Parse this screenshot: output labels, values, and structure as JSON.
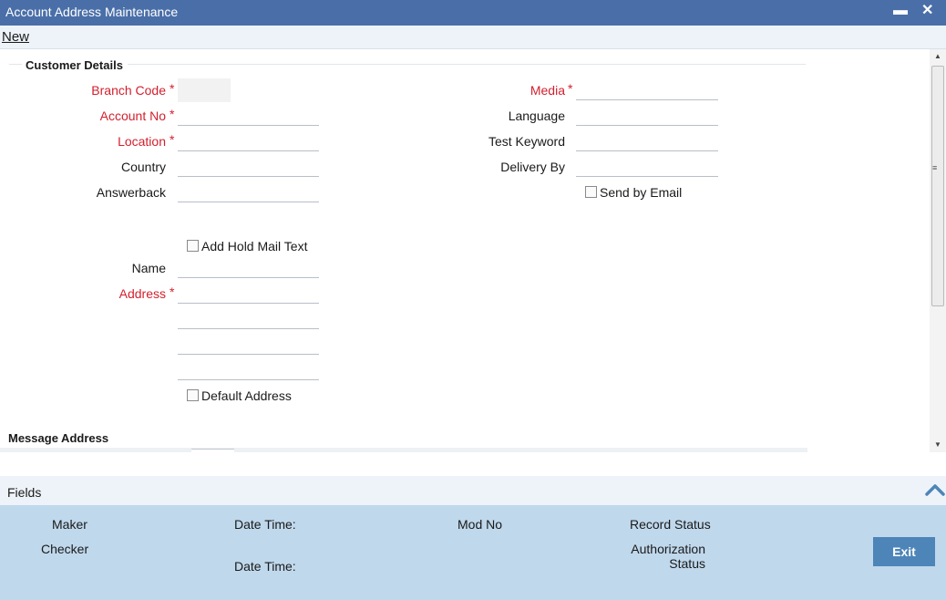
{
  "window": {
    "title": "Account Address Maintenance",
    "minimize_icon": "minimize-icon",
    "close_icon": "close-icon"
  },
  "menu": {
    "new_label": "New"
  },
  "customer_details": {
    "title": "Customer Details",
    "required_marker": "*",
    "branch_code": {
      "label": "Branch Code",
      "value": ""
    },
    "account_no": {
      "label": "Account No",
      "value": ""
    },
    "location": {
      "label": "Location",
      "value": ""
    },
    "country": {
      "label": "Country",
      "value": ""
    },
    "answerback": {
      "label": "Answerback",
      "value": ""
    },
    "media": {
      "label": "Media",
      "value": ""
    },
    "language": {
      "label": "Language",
      "value": ""
    },
    "test_keyword": {
      "label": "Test Keyword",
      "value": ""
    },
    "delivery_by": {
      "label": "Delivery By",
      "value": ""
    },
    "send_by_email": {
      "label": "Send by Email",
      "checked": false
    },
    "add_hold_mail_text": {
      "label": "Add Hold Mail Text",
      "checked": false
    },
    "name": {
      "label": "Name",
      "value": ""
    },
    "address": {
      "label": "Address",
      "lines": [
        "",
        "",
        "",
        ""
      ]
    },
    "default_address": {
      "label": "Default Address",
      "checked": false
    }
  },
  "message_address": {
    "title": "Message Address"
  },
  "fields_bar": {
    "label": "Fields",
    "collapse_icon": "chevron-up-icon"
  },
  "audit": {
    "maker": "Maker",
    "checker": "Checker",
    "date_time_1": "Date Time:",
    "date_time_2": "Date Time:",
    "mod_no": "Mod No",
    "record_status": "Record Status",
    "authorization_status_line1": "Authorization",
    "authorization_status_line2": "Status",
    "exit_label": "Exit"
  },
  "colors": {
    "title_bar": "#4a6fa8",
    "required": "#d31f2d",
    "footer": "#bfd8ec",
    "exit_button": "#4d85b8"
  }
}
